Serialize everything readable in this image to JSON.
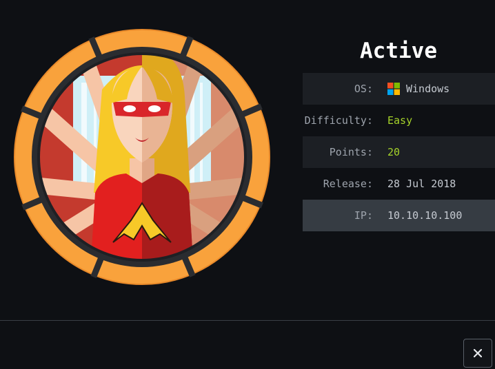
{
  "machine": {
    "name": "Active"
  },
  "info": [
    {
      "key": "OS:",
      "value": "Windows"
    },
    {
      "key": "Difficulty:",
      "value": "Easy"
    },
    {
      "key": "Points:",
      "value": "20"
    },
    {
      "key": "Release:",
      "value": "28 Jul 2018"
    },
    {
      "key": "IP:",
      "value": "10.10.10.100"
    }
  ],
  "icons": {
    "os": "windows-logo-icon",
    "close": "close-icon"
  },
  "colors": {
    "background": "#0e1014",
    "accent_lime": "#a5d32a",
    "badge_ring": "#f9a23c",
    "row_shaded": "#1c1f24",
    "row_selected": "#363c43"
  }
}
